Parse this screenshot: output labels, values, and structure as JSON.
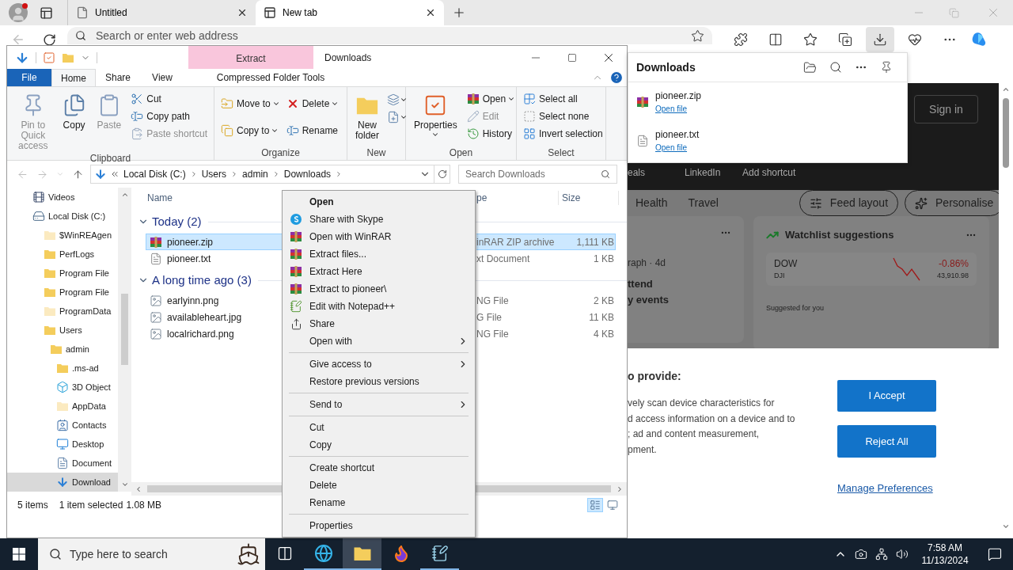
{
  "browser": {
    "tabs": [
      {
        "label": "Untitled",
        "selected": false
      },
      {
        "label": "New tab",
        "selected": true
      }
    ],
    "address_placeholder": "Search or enter web address"
  },
  "downloads_flyout": {
    "title": "Downloads",
    "items": [
      {
        "kind": "archive",
        "name": "pioneer.zip",
        "action": "Open file"
      },
      {
        "kind": "text",
        "name": "pioneer.txt",
        "action": "Open file"
      }
    ]
  },
  "news_page": {
    "sign_in": "Sign in",
    "shortcuts": [
      "eals",
      "LinkedIn",
      "Add shortcut"
    ],
    "categories": [
      "Health",
      "Travel"
    ],
    "feed_layout": "Feed layout",
    "personalise": "Personalise",
    "story": {
      "meta": "raph · 4d",
      "headline": "ttend\ny events"
    },
    "watchlist": {
      "title": "Watchlist suggestions",
      "symbol": "DOW",
      "exchange": "DJI",
      "change": "-0.86%",
      "price": "43,910.98",
      "suggested": "Suggested for you"
    },
    "consent": {
      "heading": "o provide:",
      "body": "vely scan device characteristics for\nd access information on a device and to\n; ad and content measurement,\npment.",
      "accept": "I Accept",
      "reject": "Reject All",
      "manage": "Manage Preferences"
    }
  },
  "explorer": {
    "title": "Downloads",
    "contextual_tab": "Extract",
    "ribbon_tabs": [
      {
        "label": "File",
        "kind": "file",
        "selected": false
      },
      {
        "label": "Home",
        "kind": "plain",
        "selected": true
      },
      {
        "label": "Share",
        "kind": "plain",
        "selected": false
      },
      {
        "label": "View",
        "kind": "plain",
        "selected": false
      },
      {
        "label": "Compressed Folder Tools",
        "kind": "contextual",
        "selected": false
      }
    ],
    "ribbon": {
      "clipboard": {
        "label": "Clipboard",
        "pin": {
          "label": "Pin to Quick access",
          "disabled": true
        },
        "copy": {
          "label": "Copy",
          "disabled": false
        },
        "paste": {
          "label": "Paste",
          "disabled": true
        },
        "cut": {
          "label": "Cut",
          "disabled": false
        },
        "copy_path": {
          "label": "Copy path",
          "disabled": false
        },
        "paste_shortcut": {
          "label": "Paste shortcut",
          "disabled": true
        }
      },
      "organize": {
        "label": "Organize",
        "move_to": {
          "label": "Move to",
          "disabled": false
        },
        "copy_to": {
          "label": "Copy to",
          "disabled": false
        },
        "delete": {
          "label": "Delete",
          "disabled": false
        },
        "rename": {
          "label": "Rename",
          "disabled": false
        }
      },
      "new": {
        "label": "New",
        "new_folder": {
          "label": "New\nfolder",
          "disabled": false
        }
      },
      "open": {
        "label": "Open",
        "properties": {
          "label": "Properties",
          "disabled": false
        },
        "open": {
          "label": "Open",
          "disabled": false
        },
        "edit": {
          "label": "Edit",
          "disabled": true
        },
        "history": {
          "label": "History",
          "disabled": false
        }
      },
      "select": {
        "label": "Select",
        "select_all": {
          "label": "Select all",
          "disabled": false
        },
        "select_none": {
          "label": "Select none",
          "disabled": false
        },
        "invert": {
          "label": "Invert selection",
          "disabled": false
        }
      }
    },
    "breadcrumbs": [
      "Local Disk (C:)",
      "Users",
      "admin",
      "Downloads"
    ],
    "search_placeholder": "Search Downloads",
    "navigation_pane": [
      {
        "label": "Videos",
        "kind": "videos",
        "selected": false
      },
      {
        "label": "Local Disk (C:)",
        "kind": "drive",
        "selected": false,
        "children": [
          {
            "label": "$WinREAgen",
            "kind": "hidden_folder",
            "selected": false
          },
          {
            "label": "PerfLogs",
            "kind": "folder",
            "selected": false
          },
          {
            "label": "Program File",
            "kind": "folder",
            "selected": false
          },
          {
            "label": "Program File",
            "kind": "folder",
            "selected": false
          },
          {
            "label": "ProgramData",
            "kind": "hidden_folder",
            "selected": false
          },
          {
            "label": "Users",
            "kind": "folder",
            "selected": false,
            "children": [
              {
                "label": "admin",
                "kind": "folder",
                "selected": false,
                "children": [
                  {
                    "label": ".ms-ad",
                    "kind": "folder",
                    "selected": false
                  },
                  {
                    "label": "3D Object",
                    "kind": "objects",
                    "selected": false
                  },
                  {
                    "label": "AppData",
                    "kind": "hidden_folder",
                    "selected": false
                  },
                  {
                    "label": "Contacts",
                    "kind": "contacts",
                    "selected": false
                  },
                  {
                    "label": "Desktop",
                    "kind": "desktop",
                    "selected": false
                  },
                  {
                    "label": "Document",
                    "kind": "documents",
                    "selected": false
                  },
                  {
                    "label": "Download",
                    "kind": "downloads",
                    "selected": true
                  }
                ]
              }
            ]
          }
        ]
      }
    ],
    "columns": {
      "name": "Name",
      "type": "pe",
      "size": "Size"
    },
    "groups": [
      {
        "label": "Today (2)",
        "expanded": true,
        "files": [
          {
            "kind": "archive",
            "name": "pioneer.zip",
            "type": "inRAR ZIP archive",
            "size": "1,111 KB",
            "selected": true
          },
          {
            "kind": "text",
            "name": "pioneer.txt",
            "type": "xt Document",
            "size": "1 KB",
            "selected": false
          }
        ]
      },
      {
        "label": "A long time ago (3)",
        "expanded": true,
        "files": [
          {
            "kind": "image",
            "name": "earlyinn.png",
            "type": "NG File",
            "size": "2 KB",
            "selected": false
          },
          {
            "kind": "image",
            "name": "availableheart.jpg",
            "type": "G File",
            "size": "11 KB",
            "selected": false
          },
          {
            "kind": "image",
            "name": "localrichard.png",
            "type": "NG File",
            "size": "4 KB",
            "selected": false
          }
        ]
      }
    ],
    "status": {
      "count": "5 items",
      "selection": "1 item selected",
      "size": "1.08 MB"
    },
    "views": [
      {
        "kind": "details",
        "selected": true
      },
      {
        "kind": "large_icons",
        "selected": false
      }
    ]
  },
  "context_menu": {
    "groups": [
      [
        {
          "label": "Open",
          "kind": "plain",
          "default": true,
          "submenu": false
        },
        {
          "label": "Share with Skype",
          "kind": "skype",
          "default": false,
          "submenu": false
        },
        {
          "label": "Open with WinRAR",
          "kind": "winrar",
          "default": false,
          "submenu": false
        },
        {
          "label": "Extract files...",
          "kind": "winrar",
          "default": false,
          "submenu": false
        },
        {
          "label": "Extract Here",
          "kind": "winrar",
          "default": false,
          "submenu": false
        },
        {
          "label": "Extract to pioneer\\",
          "kind": "winrar",
          "default": false,
          "submenu": false
        },
        {
          "label": "Edit with Notepad++",
          "kind": "notepad",
          "default": false,
          "submenu": false
        },
        {
          "label": "Share",
          "kind": "share",
          "default": false,
          "submenu": false
        },
        {
          "label": "Open with",
          "kind": "plain",
          "default": false,
          "submenu": true
        }
      ],
      [
        {
          "label": "Give access to",
          "kind": "plain",
          "default": false,
          "submenu": true
        },
        {
          "label": "Restore previous versions",
          "kind": "plain",
          "default": false,
          "submenu": false
        }
      ],
      [
        {
          "label": "Send to",
          "kind": "plain",
          "default": false,
          "submenu": true
        }
      ],
      [
        {
          "label": "Cut",
          "kind": "plain",
          "default": false,
          "submenu": false
        },
        {
          "label": "Copy",
          "kind": "plain",
          "default": false,
          "submenu": false
        }
      ],
      [
        {
          "label": "Create shortcut",
          "kind": "plain",
          "default": false,
          "submenu": false
        },
        {
          "label": "Delete",
          "kind": "plain",
          "default": false,
          "submenu": false
        },
        {
          "label": "Rename",
          "kind": "plain",
          "default": false,
          "submenu": false
        }
      ],
      [
        {
          "label": "Properties",
          "kind": "plain",
          "default": false,
          "submenu": false
        }
      ]
    ]
  },
  "taskbar": {
    "search_placeholder": "Type here to search",
    "apps": [
      {
        "kind": "task_view",
        "selected": false,
        "running": false
      },
      {
        "kind": "edge",
        "selected": false,
        "running": true
      },
      {
        "kind": "explorer",
        "selected": true,
        "running": true
      },
      {
        "kind": "firefox",
        "selected": false,
        "running": false
      },
      {
        "kind": "notepad",
        "selected": false,
        "running": true
      }
    ],
    "time": "7:58 AM",
    "date": "11/13/2024"
  }
}
